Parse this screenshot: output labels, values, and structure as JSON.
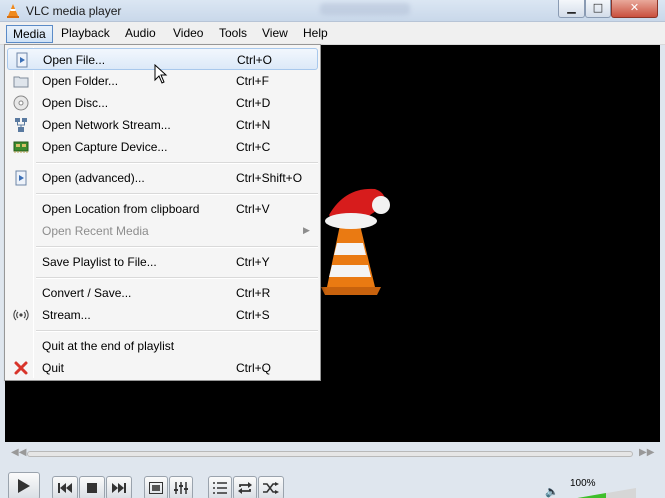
{
  "window": {
    "title": "VLC media player"
  },
  "menubar": [
    "Media",
    "Playback",
    "Audio",
    "Video",
    "Tools",
    "View",
    "Help"
  ],
  "media_menu": [
    {
      "label": "Open File...",
      "shortcut": "Ctrl+O",
      "icon": "open-file-icon",
      "highlighted": true
    },
    {
      "label": "Open Folder...",
      "shortcut": "Ctrl+F",
      "icon": "folder-icon"
    },
    {
      "label": "Open Disc...",
      "shortcut": "Ctrl+D",
      "icon": "disc-icon"
    },
    {
      "label": "Open Network Stream...",
      "shortcut": "Ctrl+N",
      "icon": "network-icon"
    },
    {
      "label": "Open Capture Device...",
      "shortcut": "Ctrl+C",
      "icon": "capture-card-icon"
    },
    {
      "label": "Open (advanced)...",
      "shortcut": "Ctrl+Shift+O",
      "icon": "open-advanced-icon"
    },
    {
      "label": "Open Location from clipboard",
      "shortcut": "Ctrl+V"
    },
    {
      "label": "Open Recent Media",
      "shortcut": "",
      "disabled": true,
      "submenu": true
    },
    {
      "label": "Save Playlist to File...",
      "shortcut": "Ctrl+Y"
    },
    {
      "label": "Convert / Save...",
      "shortcut": "Ctrl+R"
    },
    {
      "label": "Stream...",
      "shortcut": "Ctrl+S",
      "icon": "stream-icon"
    },
    {
      "label": "Quit at the end of playlist",
      "shortcut": ""
    },
    {
      "label": "Quit",
      "shortcut": "Ctrl+Q",
      "icon": "quit-icon"
    }
  ],
  "volume": {
    "label": "100%",
    "level": 1.0
  },
  "controls": [
    "play-button",
    "previous-button",
    "stop-button",
    "next-button",
    "fullscreen-button",
    "extended-settings-button",
    "playlist-button",
    "loop-button",
    "shuffle-button"
  ],
  "colors": {
    "menu_highlight": "#dce9f8",
    "video_bg": "#000000",
    "volume_green": "#3fbf2b"
  }
}
